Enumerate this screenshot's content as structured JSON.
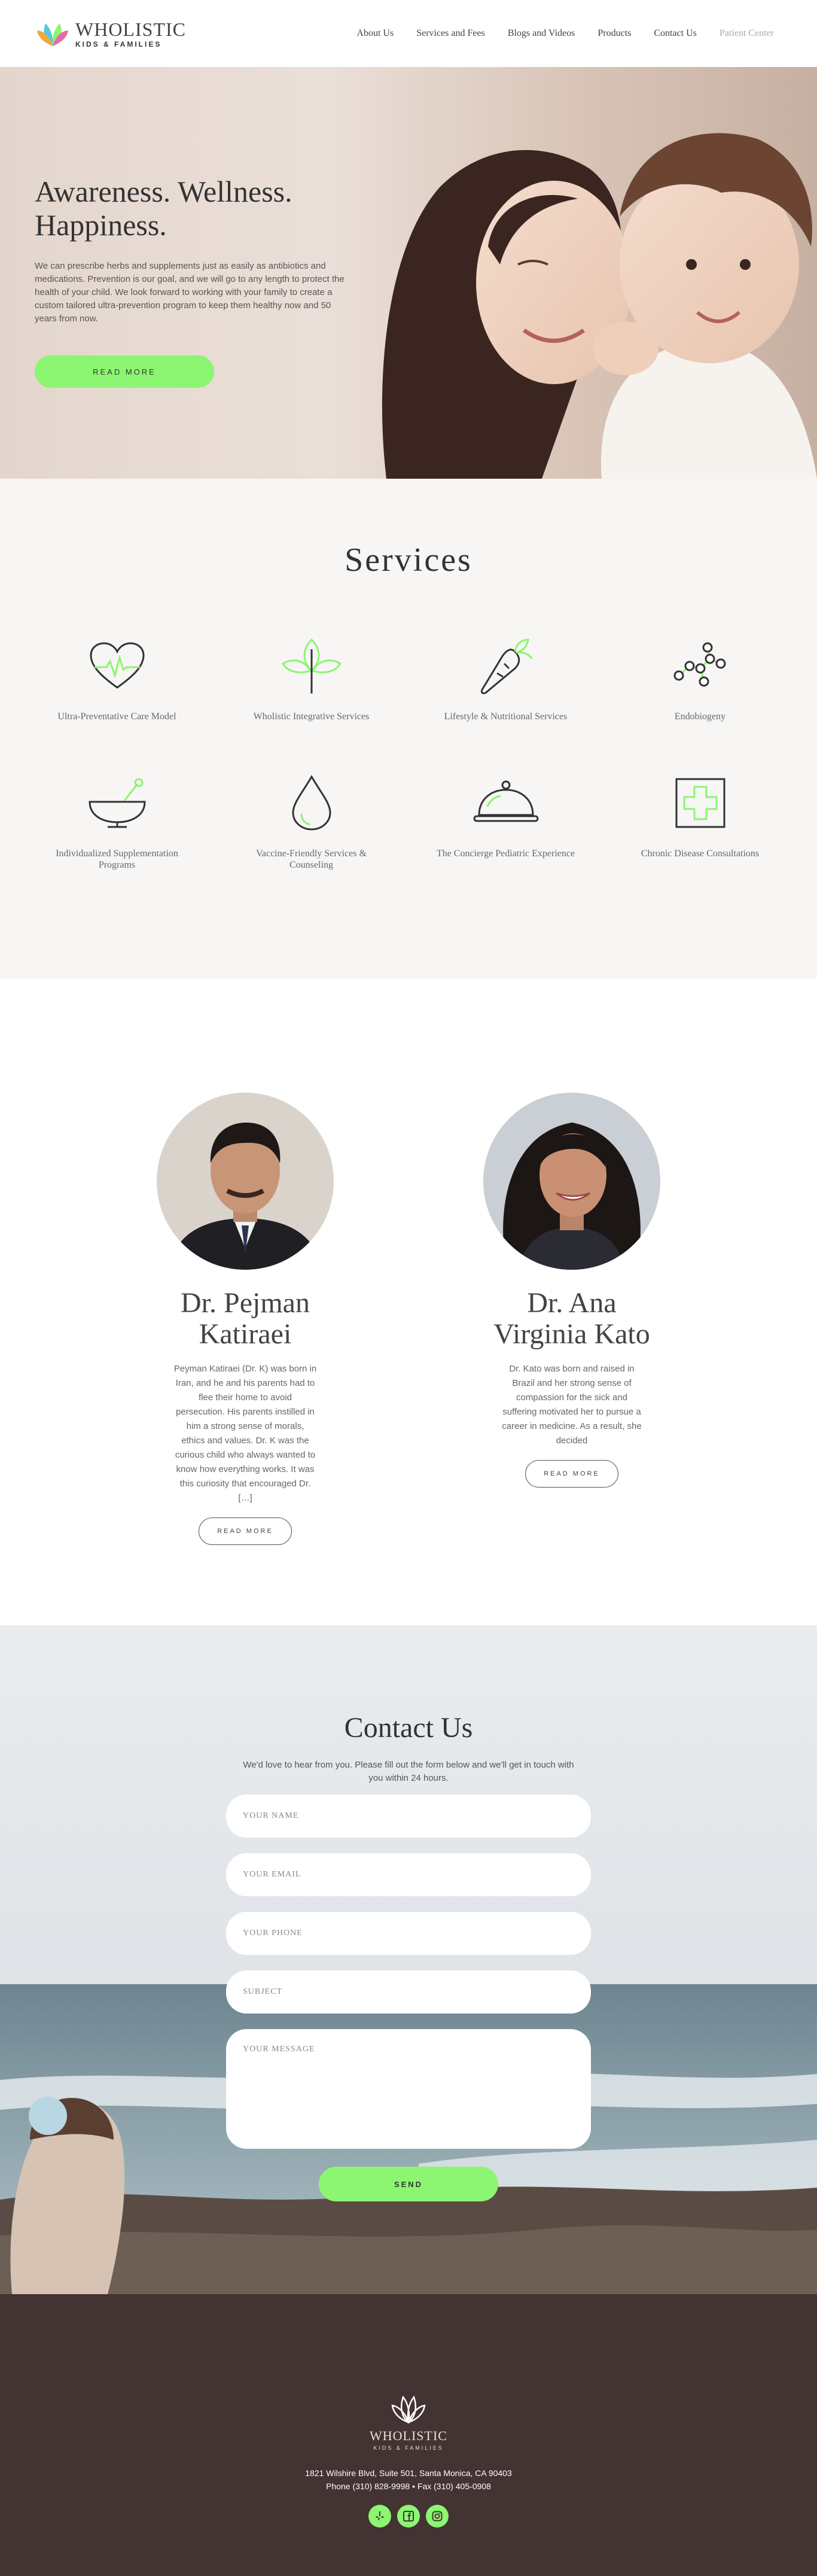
{
  "header": {
    "logo_main": "WHOLISTIC",
    "logo_sub": "KIDS & FAMILIES",
    "nav": [
      "About Us",
      "Services and Fees",
      "Blogs and Videos",
      "Products",
      "Contact Us",
      "Patient Center"
    ]
  },
  "hero": {
    "title": "Awareness. Wellness. Happiness.",
    "text": "We can prescribe herbs and supplements just as easily as antibiotics and medications. Prevention is our goal, and we will go to any length to protect the health of your child. We look forward to working with your family to create a custom tailored ultra-prevention program to keep them healthy now and 50 years from now.",
    "button": "READ MORE"
  },
  "services": {
    "title": "Services",
    "items": [
      {
        "label": "Ultra-Preventative Care Model",
        "icon": "heart-pulse-icon"
      },
      {
        "label": "Wholistic Integrative Services",
        "icon": "leaf-plant-icon"
      },
      {
        "label": "Lifestyle & Nutritional Services",
        "icon": "carrot-icon"
      },
      {
        "label": "Endobiogeny",
        "icon": "molecule-icon"
      },
      {
        "label": "Individualized Supplementation Programs",
        "icon": "mortar-pestle-icon"
      },
      {
        "label": "Vaccine-Friendly Services & Counseling",
        "icon": "drop-icon"
      },
      {
        "label": "The Concierge Pediatric Experience",
        "icon": "cloche-icon"
      },
      {
        "label": "Chronic Disease Consultations",
        "icon": "medical-cross-icon"
      }
    ]
  },
  "doctors": [
    {
      "name": "Dr. Pejman Katiraei",
      "bio": "Peyman Katiraei (Dr. K) was born in Iran, and he and his parents had to flee their home to avoid persecution. His parents instilled in him a strong sense of morals, ethics and values. Dr. K was the curious child who always wanted to know how everything works. It was this curiosity that encouraged Dr. […]",
      "button": "READ MORE"
    },
    {
      "name": "Dr. Ana Virginia Kato",
      "bio": "Dr. Kato was born and raised in Brazil and her strong sense of compassion for the sick and suffering motivated her to pursue a career in medicine. As a result, she decided",
      "button": "READ MORE"
    }
  ],
  "contact": {
    "title": "Contact Us",
    "subtitle": "We'd love to hear from you. Please fill out the form below and we'll get in touch with you within 24 hours.",
    "placeholders": {
      "name": "YOUR NAME",
      "email": "YOUR EMAIL",
      "phone": "YOUR PHONE",
      "subject": "SUBJECT",
      "message": "YOUR MESSAGE"
    },
    "button": "SEND"
  },
  "footer": {
    "logo_main": "WHOLISTIC",
    "logo_sub": "KIDS & FAMILIES",
    "address": "1821 Wilshire Blvd, Suite 501, Santa Monica, CA 90403",
    "phone_fax": "Phone (310) 828-9998 • Fax (310) 405-0908",
    "socials": [
      "yelp-icon",
      "facebook-icon",
      "instagram-icon"
    ]
  },
  "colors": {
    "accent": "#8cf571",
    "footer_bg": "#433332",
    "services_bg": "#f7f6f5"
  }
}
